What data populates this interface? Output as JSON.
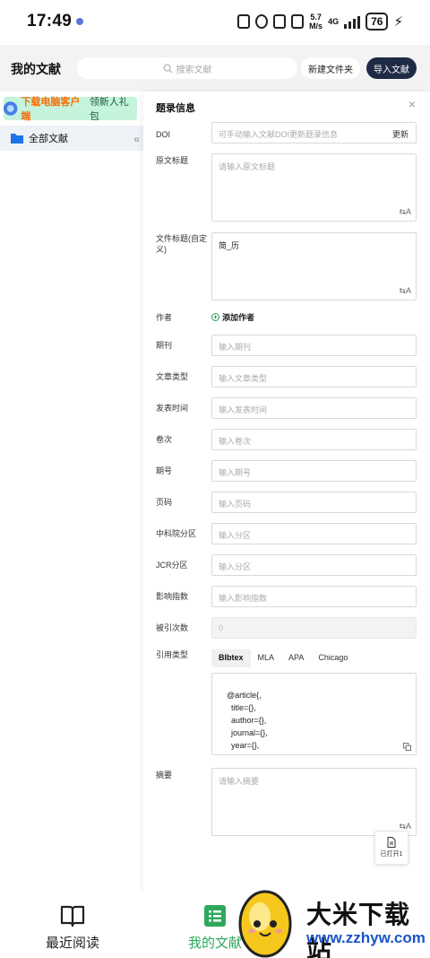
{
  "status_bar": {
    "time": "17:49",
    "net_speed_value": "5.7",
    "net_speed_unit": "M/s",
    "network": "4G",
    "battery": "76"
  },
  "header": {
    "title": "我的文献",
    "search_placeholder": "搜索文献",
    "new_folder_label": "新建文件夹",
    "import_label": "导入文献"
  },
  "sidebar": {
    "promo_highlight": "下载电脑客户端",
    "promo_text": "领新人礼包",
    "items": [
      {
        "label": "全部文献"
      }
    ]
  },
  "panel": {
    "title": "题录信息",
    "doi": {
      "label": "DOI",
      "placeholder": "可手动输入文献DOI更新题录信息",
      "action": "更新"
    },
    "original_title": {
      "label": "原文标题",
      "placeholder": "请输入原文标题"
    },
    "file_title": {
      "label": "文件标题(自定义)",
      "value": "简_历"
    },
    "author": {
      "label": "作者",
      "action": "添加作者"
    },
    "journal": {
      "label": "期刊",
      "placeholder": "输入期刊"
    },
    "article_type": {
      "label": "文章类型",
      "placeholder": "输入文章类型"
    },
    "pub_date": {
      "label": "发表时间",
      "placeholder": "输入发表时间"
    },
    "volume": {
      "label": "卷次",
      "placeholder": "输入卷次"
    },
    "issue": {
      "label": "期号",
      "placeholder": "输入期号"
    },
    "pages": {
      "label": "页码",
      "placeholder": "输入页码"
    },
    "cas_zone": {
      "label": "中科院分区",
      "placeholder": "输入分区"
    },
    "jcr_zone": {
      "label": "JCR分区",
      "placeholder": "输入分区"
    },
    "impact_factor": {
      "label": "影响指数",
      "placeholder": "输入影响指数"
    },
    "citations": {
      "label": "被引次数",
      "value": "0"
    },
    "cite_type": {
      "label": "引用类型",
      "tabs": [
        "BIbtex",
        "MLA",
        "APA",
        "Chicago"
      ],
      "active_tab": "BIbtex",
      "content": "@article{,\n      title={},\n      author={},\n      journal={},\n      year={},\n      volume={},\n      pages={}"
    },
    "abstract": {
      "label": "摘要",
      "placeholder": "请输入摘要"
    },
    "opened_label": "已打开1"
  },
  "bottom_nav": {
    "items": [
      {
        "label": "最近阅读",
        "icon": "book-icon"
      },
      {
        "label": "我的文献",
        "icon": "list-icon"
      }
    ],
    "active_color": "#2ea85b"
  },
  "watermark": {
    "title": "大米下载站",
    "url": "www.zzhyw.com"
  }
}
